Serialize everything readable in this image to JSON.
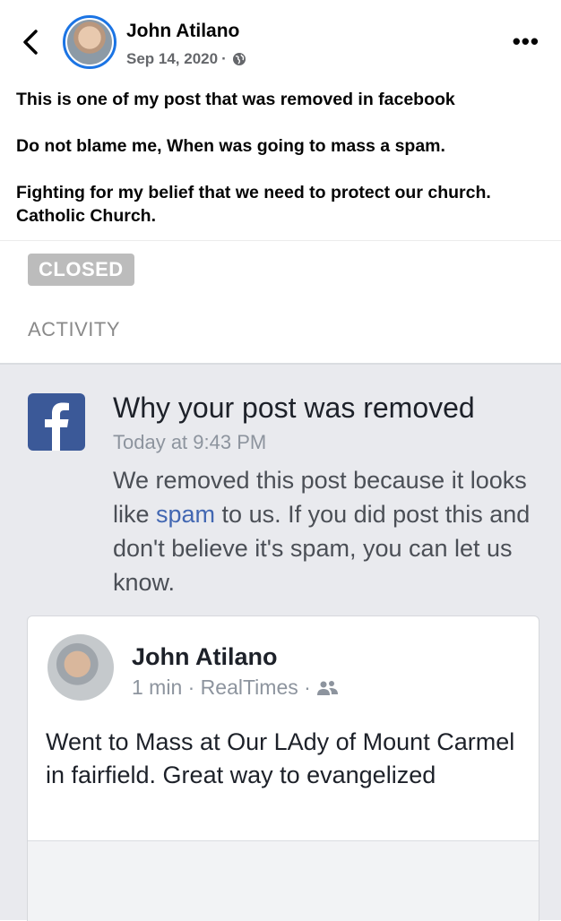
{
  "header": {
    "author": "John Atilano",
    "date": "Sep 14, 2020",
    "separator": "·"
  },
  "caption": {
    "lines": [
      "This is one of my post that was removed in facebook",
      "Do not blame me, When was going to mass a spam.",
      "Fighting for my belief that we need to protect our church. Catholic Church."
    ]
  },
  "shot": {
    "status_badge": "CLOSED",
    "section_label": "ACTIVITY",
    "notice": {
      "title": "Why your post was removed",
      "time": "Today at 9:43 PM",
      "body_before": "We removed this post because it looks like ",
      "link": "spam",
      "body_after": " to us. If you did post this and don't believe it's spam, you can let us know."
    },
    "post": {
      "author": "John Atilano",
      "meta": "1 min · RealTimes ·",
      "text": "Went to Mass at Our LAdy of Mount Carmel in fairfield. Great way to evangelized"
    }
  },
  "icons": {
    "back": "chevron-left-icon",
    "more": "more-horizontal-icon",
    "privacy": "globe-icon",
    "brand": "facebook-logo-icon",
    "audience": "friends-icon"
  },
  "colors": {
    "accent": "#1b74e4",
    "fb_brand": "#3b5998",
    "link": "#4267b2",
    "panel_bg": "#e9eaee",
    "badge_bg": "#bcbcbc"
  }
}
